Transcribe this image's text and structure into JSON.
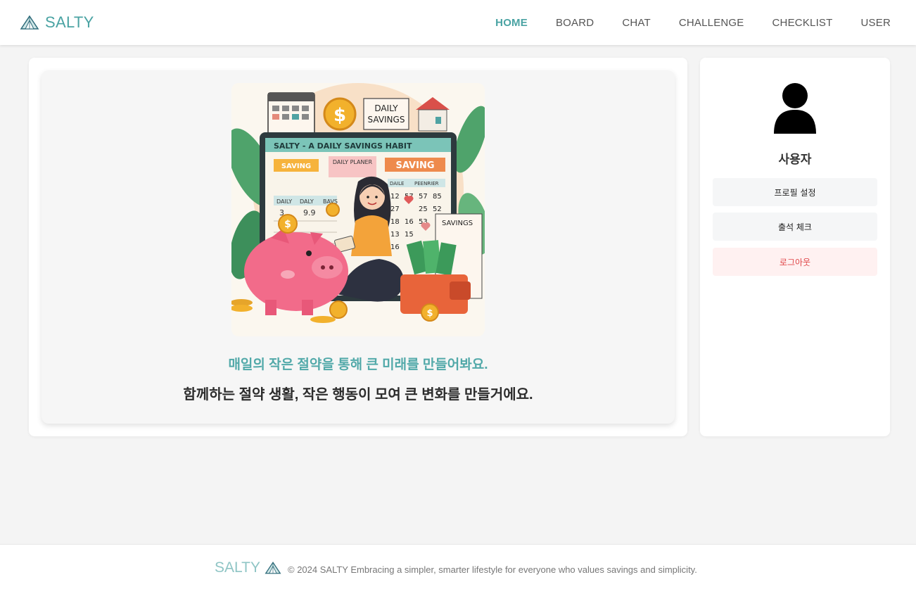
{
  "app": {
    "brand": "SALTY",
    "logo_icon": "salt-pile-icon"
  },
  "nav": {
    "items": [
      {
        "label": "HOME",
        "active": true
      },
      {
        "label": "BOARD",
        "active": false
      },
      {
        "label": "CHAT",
        "active": false
      },
      {
        "label": "CHALLENGE",
        "active": false
      },
      {
        "label": "CHECKLIST",
        "active": false
      },
      {
        "label": "USER",
        "active": false
      }
    ]
  },
  "hero": {
    "image": {
      "banner": "SALTY  - A DAILY SAVINGS HABIT",
      "sign_daily": "DAILY",
      "sign_savings": "SAVINGS",
      "tag_saving_small": "SAVING",
      "tag_planner": "DAILY PLANER",
      "tag_saving_big": "SAVING",
      "tag_savings_note": "SAVINGS",
      "col_headers": [
        "DAILY",
        "DALY",
        "BAVS"
      ],
      "col_headers_right": [
        "DAILE",
        "PEENRIER"
      ],
      "left_nums": [
        "3",
        "9.9"
      ],
      "grid_nums": [
        "12",
        "57",
        "57",
        "85",
        "27",
        "25",
        "52",
        "18",
        "16",
        "53",
        "13",
        "15",
        "16",
        "15"
      ],
      "coin_symbol": "$"
    },
    "line1": "매일의 작은 절약을 통해 큰 미래를 만들어봐요.",
    "line2": "함께하는 절약 생활, 작은 행동이 모여 큰 변화를 만들거에요."
  },
  "profile": {
    "avatar_icon": "user-avatar-icon",
    "name": "사용자",
    "buttons": {
      "profile_settings": "프로필 설정",
      "attendance": "출석 체크",
      "logout": "로그아웃"
    }
  },
  "footer": {
    "brand": "SALTY",
    "copyright": "© 2024 SALTY Embracing a simpler, smarter lifestyle for everyone who values savings and simplicity."
  },
  "colors": {
    "brand_teal": "#4aa3a3",
    "logout_red": "#e0484a",
    "background": "#f4f4f4"
  }
}
